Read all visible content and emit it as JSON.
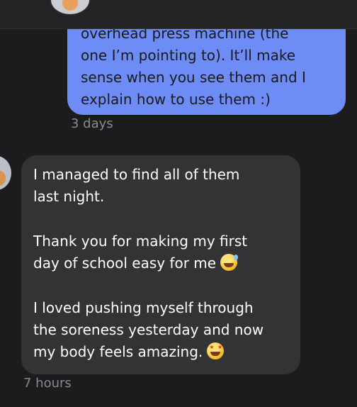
{
  "outgoing": {
    "lines": [
      "overhead press machine (the",
      "one I’m pointing to). It’ll make",
      "sense when you see them and I",
      "explain how to use them :)"
    ],
    "timestamp": "3 days",
    "bubble_color": "#6e8cf5"
  },
  "incoming": {
    "lines": [
      "I managed to find all of them",
      "last night.",
      "Thank you for making my first",
      "day of school easy for me",
      "I loved pushing myself through",
      "the soreness yesterday and now",
      "my body feels amazing."
    ],
    "emojis": [
      "grinning-sweat-emoji",
      "star-struck-emoji"
    ],
    "timestamp": "7 hours",
    "bubble_color": "#333335"
  },
  "colors": {
    "background": "#1c1c1e",
    "timestamp": "#8a8a8e"
  }
}
